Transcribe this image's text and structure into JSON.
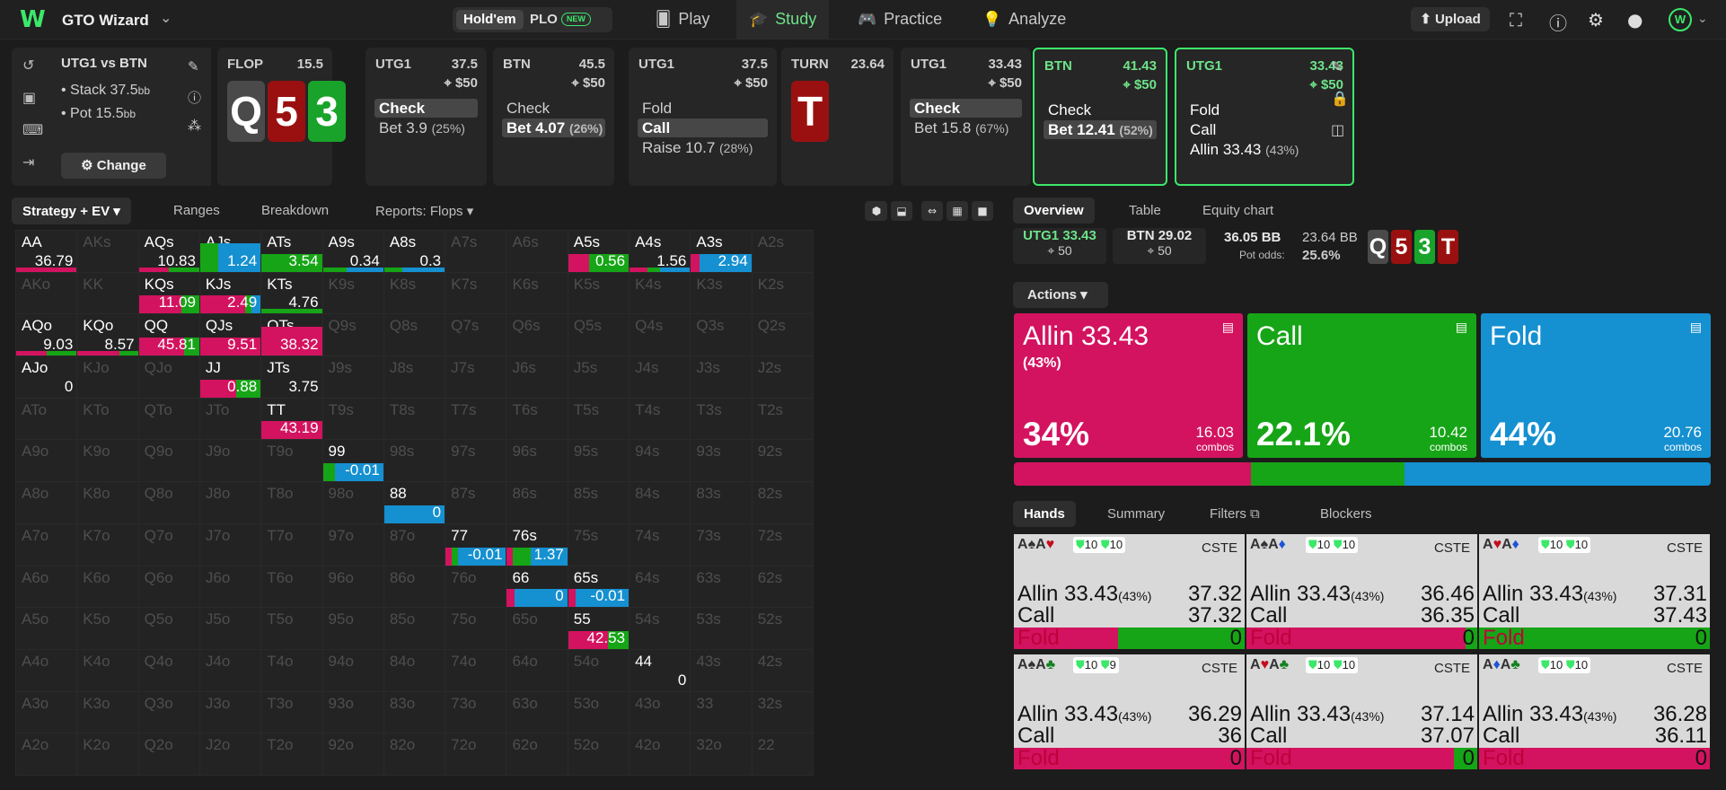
{
  "top": {
    "brand": "GTO Wizard",
    "game_tabs": [
      "Hold'em",
      "PLO"
    ],
    "new_badge": "NEW",
    "nav": [
      "Play",
      "Study",
      "Practice",
      "Analyze"
    ],
    "upload": "Upload",
    "avatar": "W"
  },
  "info": {
    "title": "UTG1 vs BTN",
    "stack": "Stack 37.5",
    "pot": "Pot 15.5",
    "unit": "bb",
    "change": "Change"
  },
  "strip": [
    {
      "hd": "FLOP",
      "hdr": "15.5",
      "cards": [
        "Q",
        "5",
        "3"
      ]
    },
    {
      "hd": "UTG1",
      "hdr": "37.5",
      "pot": "$50",
      "acts": [
        {
          "t": "Check",
          "sel": true
        },
        {
          "t": "Bet 3.9",
          "p": "(25%)"
        }
      ]
    },
    {
      "hd": "BTN",
      "hdr": "45.5",
      "pot": "$50",
      "acts": [
        {
          "t": "Check"
        },
        {
          "t": "Bet 4.07",
          "p": "(26%)",
          "sel": true
        }
      ]
    },
    {
      "hd": "UTG1",
      "hdr": "37.5",
      "pot": "$50",
      "acts": [
        {
          "t": "Fold"
        },
        {
          "t": "Call",
          "sel": true
        },
        {
          "t": "Raise 10.7",
          "p": "(28%)"
        }
      ]
    },
    {
      "hd": "TURN",
      "hdr": "23.64",
      "cards": [
        "T"
      ]
    },
    {
      "hd": "UTG1",
      "hdr": "33.43",
      "pot": "$50",
      "acts": [
        {
          "t": "Check",
          "sel": true
        },
        {
          "t": "Bet 15.8",
          "p": "(67%)"
        }
      ]
    },
    {
      "hd": "BTN",
      "hdr": "41.43",
      "pot": "$50",
      "acts": [
        {
          "t": "Check"
        },
        {
          "t": "Bet 12.41",
          "p": "(52%)",
          "sel": true
        }
      ]
    },
    {
      "hd": "UTG1",
      "hdr": "33.43",
      "pot": "$50",
      "acts": [
        {
          "t": "Fold"
        },
        {
          "t": "Call"
        },
        {
          "t": "Allin 33.43",
          "p": "(43%)"
        }
      ]
    }
  ],
  "grid_tabs": [
    "Strategy + EV",
    "Ranges",
    "Breakdown",
    "Reports: Flops"
  ],
  "hands": [
    [
      "AA",
      "AKs",
      "AQs",
      "AJs",
      "ATs",
      "A9s",
      "A8s",
      "A7s",
      "A6s",
      "A5s",
      "A4s",
      "A3s",
      "A2s"
    ],
    [
      "AKo",
      "KK",
      "KQs",
      "KJs",
      "KTs",
      "K9s",
      "K8s",
      "K7s",
      "K6s",
      "K5s",
      "K4s",
      "K3s",
      "K2s"
    ],
    [
      "AQo",
      "KQo",
      "QQ",
      "QJs",
      "QTs",
      "Q9s",
      "Q8s",
      "Q7s",
      "Q6s",
      "Q5s",
      "Q4s",
      "Q3s",
      "Q2s"
    ],
    [
      "AJo",
      "KJo",
      "QJo",
      "JJ",
      "JTs",
      "J9s",
      "J8s",
      "J7s",
      "J6s",
      "J5s",
      "J4s",
      "J3s",
      "J2s"
    ],
    [
      "ATo",
      "KTo",
      "QTo",
      "JTo",
      "TT",
      "T9s",
      "T8s",
      "T7s",
      "T6s",
      "T5s",
      "T4s",
      "T3s",
      "T2s"
    ],
    [
      "A9o",
      "K9o",
      "Q9o",
      "J9o",
      "T9o",
      "99",
      "98s",
      "97s",
      "96s",
      "95s",
      "94s",
      "93s",
      "92s"
    ],
    [
      "A8o",
      "K8o",
      "Q8o",
      "J8o",
      "T8o",
      "98o",
      "88",
      "87s",
      "86s",
      "85s",
      "84s",
      "83s",
      "82s"
    ],
    [
      "A7o",
      "K7o",
      "Q7o",
      "J7o",
      "T7o",
      "97o",
      "87o",
      "77",
      "76s",
      "75s",
      "74s",
      "73s",
      "72s"
    ],
    [
      "A6o",
      "K6o",
      "Q6o",
      "J6o",
      "T6o",
      "96o",
      "86o",
      "76o",
      "66",
      "65s",
      "64s",
      "63s",
      "62s"
    ],
    [
      "A5o",
      "K5o",
      "Q5o",
      "J5o",
      "T5o",
      "95o",
      "85o",
      "75o",
      "65o",
      "55",
      "54s",
      "53s",
      "52s"
    ],
    [
      "A4o",
      "K4o",
      "Q4o",
      "J4o",
      "T4o",
      "94o",
      "84o",
      "74o",
      "64o",
      "54o",
      "44",
      "43s",
      "42s"
    ],
    [
      "A3o",
      "K3o",
      "Q3o",
      "J3o",
      "T3o",
      "93o",
      "83o",
      "73o",
      "63o",
      "53o",
      "43o",
      "33",
      "32s"
    ],
    [
      "A2o",
      "K2o",
      "Q2o",
      "J2o",
      "T2o",
      "92o",
      "82o",
      "72o",
      "62o",
      "52o",
      "42o",
      "32o",
      "22"
    ]
  ],
  "live": {
    "AA": {
      "ev": "36.79",
      "mix": [
        1.0,
        0,
        0
      ],
      "thin": true
    },
    "AQs": {
      "ev": "10.83",
      "mix": [
        0.5,
        0.5,
        0
      ],
      "thin": true
    },
    "AJs": {
      "ev": "1.24",
      "mix": [
        0,
        0.3,
        0.7
      ],
      "full": true
    },
    "ATs": {
      "ev": "3.54",
      "mix": [
        0,
        1.0,
        0
      ]
    },
    "A9s": {
      "ev": "0.34",
      "mix": [
        0,
        0.4,
        0.6
      ],
      "thin": true
    },
    "A8s": {
      "ev": "0.3",
      "mix": [
        0,
        0.3,
        0.7
      ],
      "thin": true
    },
    "A5s": {
      "ev": "0.56",
      "mix": [
        0.35,
        0.65,
        0
      ]
    },
    "A4s": {
      "ev": "1.56",
      "mix": [
        0.3,
        0.2,
        0.5
      ],
      "thin": true
    },
    "A3s": {
      "ev": "2.94",
      "mix": [
        0.15,
        0,
        0.85
      ]
    },
    "KQs": {
      "ev": "11.09",
      "mix": [
        0.7,
        0.3,
        0
      ]
    },
    "KJs": {
      "ev": "2.49",
      "mix": [
        0.75,
        0.1,
        0.15
      ]
    },
    "KTs": {
      "ev": "4.76",
      "mix": [
        0,
        1.0,
        0
      ],
      "thin": true
    },
    "AQo": {
      "ev": "9.03",
      "mix": [
        0.5,
        0.5,
        0
      ],
      "thin": true
    },
    "KQo": {
      "ev": "8.57",
      "mix": [
        0.7,
        0.3,
        0
      ],
      "thin": true
    },
    "QQ": {
      "ev": "45.81",
      "mix": [
        0.75,
        0.25,
        0
      ]
    },
    "QJs": {
      "ev": "9.51",
      "mix": [
        1.0,
        0,
        0
      ]
    },
    "QTs": {
      "ev": "38.32",
      "mix": [
        1.0,
        0,
        0
      ],
      "full": true
    },
    "AJo": {
      "ev": "0",
      "mix": [
        0,
        0,
        0
      ]
    },
    "JJ": {
      "ev": "0.88",
      "mix": [
        0.6,
        0.4,
        0
      ]
    },
    "JTs": {
      "ev": "3.75",
      "mix": [
        0,
        0,
        0
      ]
    },
    "TT": {
      "ev": "43.19",
      "mix": [
        1.0,
        0,
        0
      ]
    },
    "99": {
      "ev": "-0.01",
      "mix": [
        0,
        0.2,
        0.8
      ]
    },
    "88": {
      "ev": "0",
      "mix": [
        0,
        0,
        1.0
      ]
    },
    "77": {
      "ev": "-0.01",
      "mix": [
        0.1,
        0.1,
        0.8
      ]
    },
    "76s": {
      "ev": "1.37",
      "mix": [
        0.1,
        0.3,
        0.6
      ]
    },
    "66": {
      "ev": "0",
      "mix": [
        0.12,
        0,
        0.88
      ]
    },
    "65s": {
      "ev": "-0.01",
      "mix": [
        0.12,
        0,
        0.88
      ]
    },
    "55": {
      "ev": "42.53",
      "mix": [
        0.65,
        0.35,
        0
      ]
    },
    "44": {
      "ev": "0",
      "mix": [
        0,
        0,
        0
      ]
    }
  },
  "overview": {
    "tabs": [
      "Overview",
      "Table",
      "Equity chart"
    ],
    "p1": "UTG1 33.43",
    "p1s": "50",
    "p2": "BTN 29.02",
    "p2s": "50",
    "pot": "36.05 BB",
    "pot2": "23.64 BB",
    "odds_l": "Pot odds:",
    "odds": "25.6%",
    "board": [
      "Q",
      "5",
      "3",
      "T"
    ]
  },
  "actions_btn": "Actions",
  "actions": [
    {
      "name": "Allin 33.43",
      "sub": "(43%)",
      "pct": "34%",
      "combos": "16.03",
      "color": "#d3135f"
    },
    {
      "name": "Call",
      "sub": "",
      "pct": "22.1%",
      "combos": "10.42",
      "color": "#16a516"
    },
    {
      "name": "Fold",
      "sub": "",
      "pct": "44%",
      "combos": "20.76",
      "color": "#1590d1"
    }
  ],
  "combos_label": "combos",
  "freq": [
    0.34,
    0.221,
    0.44
  ],
  "hand_tabs": [
    "Hands",
    "Summary",
    "Filters",
    "Blockers"
  ],
  "hand_cards": [
    {
      "cards": [
        [
          "A",
          "♠",
          "blk2"
        ],
        [
          "A",
          "♥",
          "red"
        ]
      ],
      "b1": "10",
      "b2": "10",
      "cs": "CSTE",
      "allin": "37.32",
      "call": "37.32",
      "fold": "0",
      "mix": [
        0.45,
        0.55,
        0
      ]
    },
    {
      "cards": [
        [
          "A",
          "♠",
          "blk2"
        ],
        [
          "A",
          "♦",
          "blu"
        ]
      ],
      "b1": "10",
      "b2": "10",
      "cs": "CSTE",
      "allin": "36.46",
      "call": "36.35",
      "fold": "0",
      "mix": [
        0.95,
        0.05,
        0
      ]
    },
    {
      "cards": [
        [
          "A",
          "♥",
          "red"
        ],
        [
          "A",
          "♦",
          "blu"
        ]
      ],
      "b1": "10",
      "b2": "10",
      "cs": "CSTE",
      "allin": "37.31",
      "call": "37.43",
      "fold": "0",
      "mix": [
        0,
        1.0,
        0
      ]
    },
    {
      "cards": [
        [
          "A",
          "♠",
          "blk2"
        ],
        [
          "A",
          "♣",
          "grn"
        ]
      ],
      "b1": "10",
      "b2": "9",
      "cs": "CSTE",
      "allin": "36.29",
      "call": "36",
      "fold": "0",
      "mix": [
        1.0,
        0,
        0
      ]
    },
    {
      "cards": [
        [
          "A",
          "♥",
          "red"
        ],
        [
          "A",
          "♣",
          "grn"
        ]
      ],
      "b1": "10",
      "b2": "10",
      "cs": "CSTE",
      "allin": "37.14",
      "call": "37.07",
      "fold": "0",
      "mix": [
        0.9,
        0.1,
        0
      ]
    },
    {
      "cards": [
        [
          "A",
          "♦",
          "blu"
        ],
        [
          "A",
          "♣",
          "grn"
        ]
      ],
      "b1": "10",
      "b2": "10",
      "cs": "CSTE",
      "allin": "36.28",
      "call": "36.11",
      "fold": "0",
      "mix": [
        1.0,
        0,
        0
      ]
    }
  ],
  "row_labels": {
    "allin": "Allin 33.43",
    "allin_p": "(43%)",
    "call": "Call",
    "fold": "Fold"
  }
}
